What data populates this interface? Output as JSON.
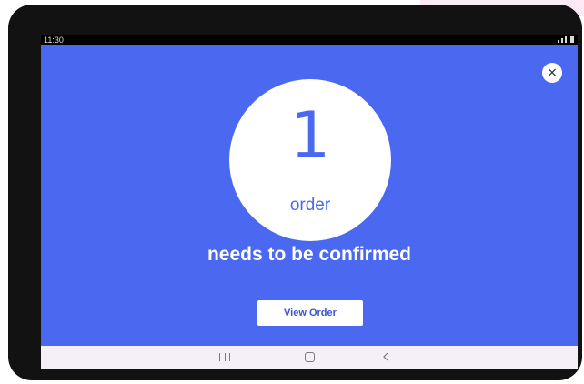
{
  "status_bar": {
    "time": "11:30"
  },
  "dialog": {
    "count": "1",
    "unit": "order",
    "message": "needs to be confirmed",
    "view_button_label": "View Order",
    "close_glyph": "×"
  },
  "colors": {
    "background": "#4a69f0",
    "accent": "#4a69f0",
    "button_text": "#3b55cc",
    "device_frame": "#121212",
    "nav_bar": "#f5eff7"
  },
  "icons": {
    "close": "close-icon",
    "recent_apps": "recent-apps-icon",
    "home": "home-icon",
    "back": "back-icon",
    "signal": "signal-icon",
    "battery": "battery-icon"
  }
}
